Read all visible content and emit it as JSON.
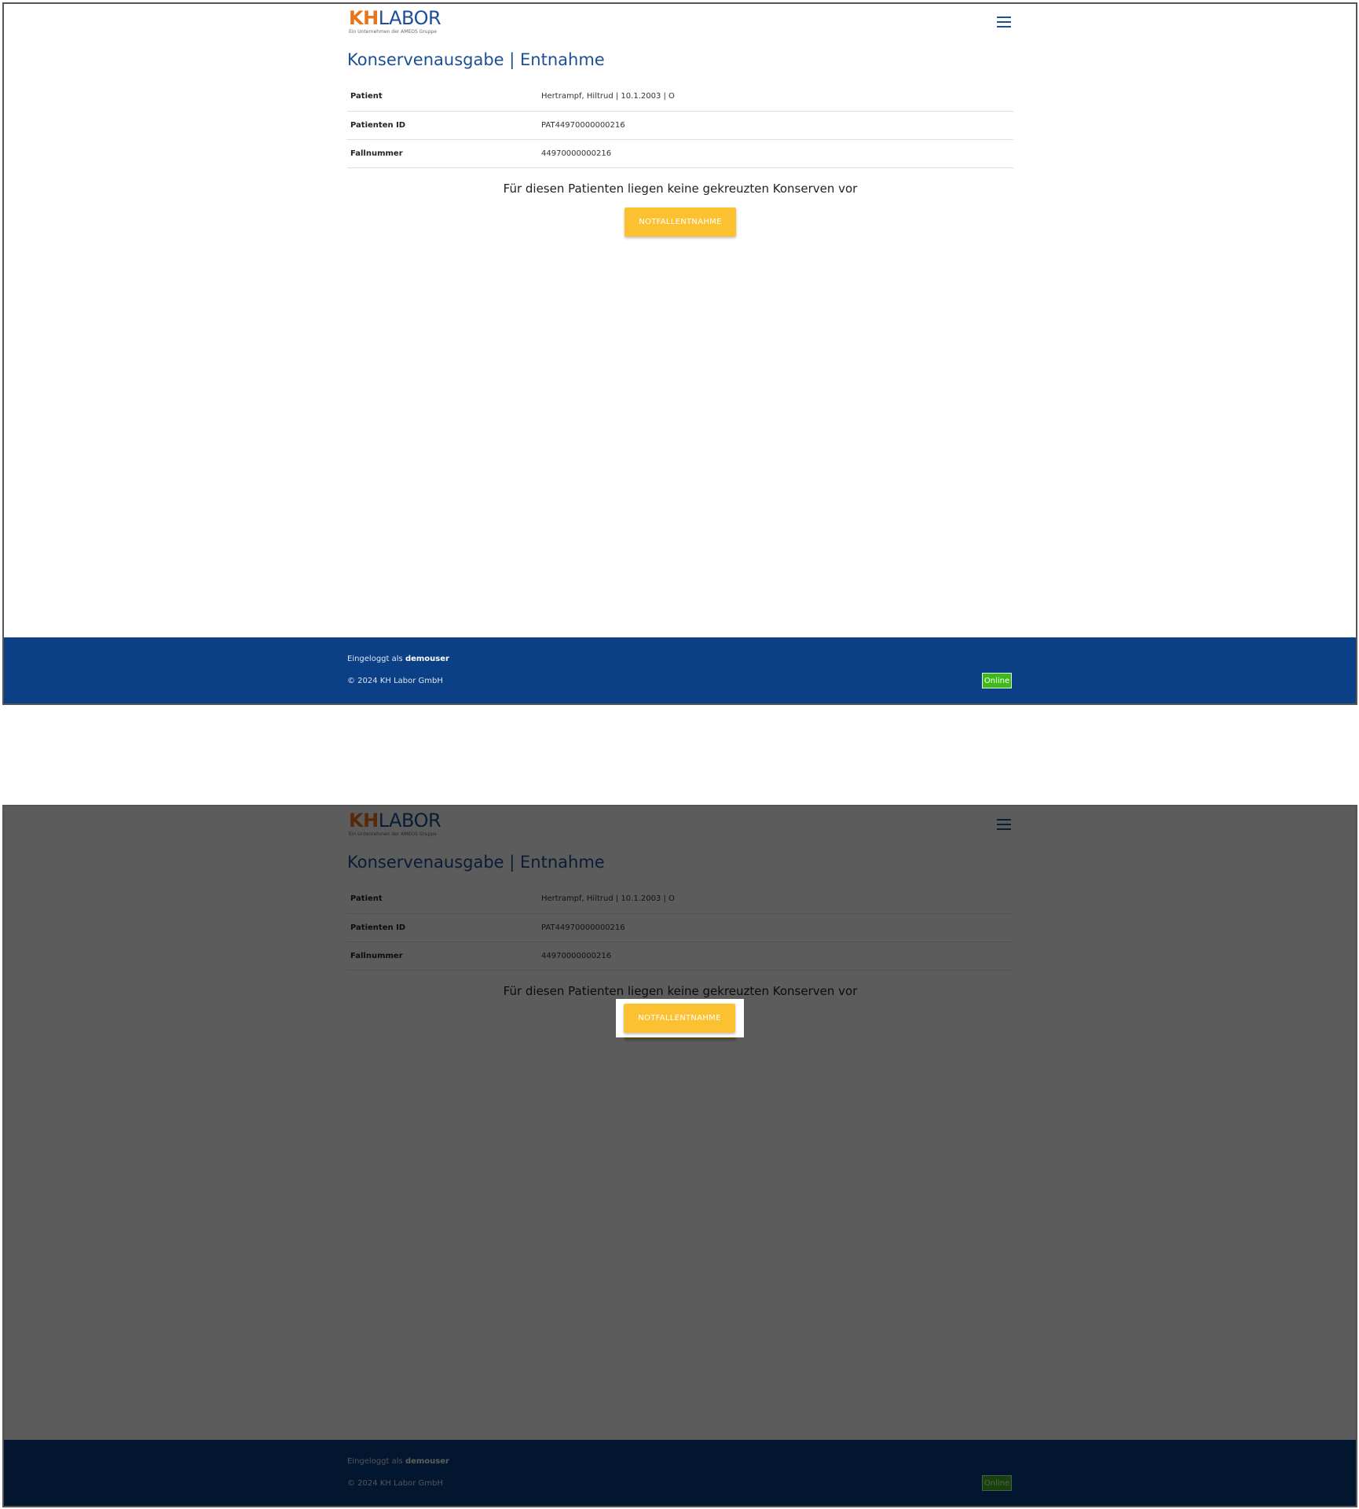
{
  "brand": {
    "logo_kh": "KH",
    "logo_labor": "LABOR",
    "logo_tagline": "Ein Unternehmen der AMEOS Gruppe"
  },
  "header": {
    "menu_icon": "hamburger-menu-icon"
  },
  "page": {
    "title": "Konservenausgabe | Entnahme"
  },
  "patient_info": {
    "rows": [
      {
        "label": "Patient",
        "value": "Hertrampf, Hiltrud | 10.1.2003 | O"
      },
      {
        "label": "Patienten ID",
        "value": "PAT44970000000216"
      },
      {
        "label": "Fallnummer",
        "value": "44970000000216"
      }
    ]
  },
  "notice": "Für diesen Patienten liegen keine gekreuzten Konserven vor",
  "actions": {
    "emergency_label": "NOTFALLENTNAHME"
  },
  "footer": {
    "logged_in_prefix": "Eingeloggt als",
    "username": "demouser",
    "copyright": "© 2024 KH Labor GmbH",
    "status": "Online"
  },
  "colors": {
    "brand_blue": "#1c4f97",
    "brand_orange": "#e8741c",
    "button_yellow": "#fcc131",
    "footer_blue": "#0b3f86",
    "status_green": "#3cbb1b"
  }
}
